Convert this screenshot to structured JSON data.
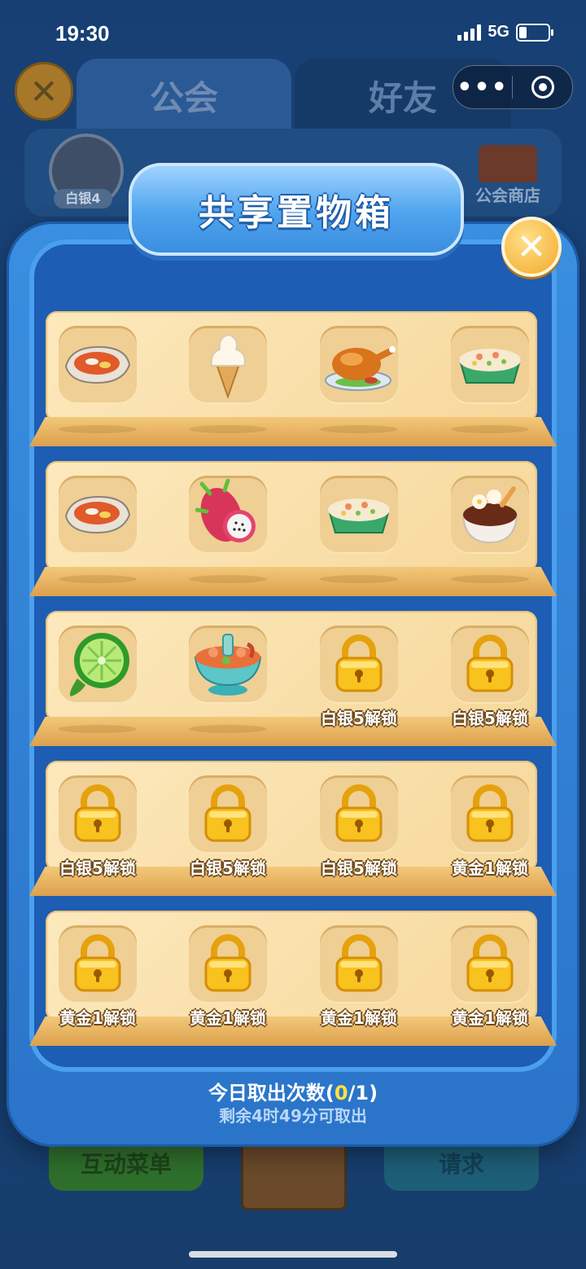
{
  "status_bar": {
    "time": "19:30",
    "network": "5G",
    "battery_level": 0.25
  },
  "background": {
    "tabs": [
      {
        "label": "公会"
      },
      {
        "label": "好友"
      }
    ],
    "badge": {
      "rank": "白银4"
    },
    "guild_shop": {
      "label": "公会商店"
    },
    "bottom": {
      "menu_label": "互动菜单",
      "request_label": "请求"
    },
    "mini_program": {
      "more": "•••"
    }
  },
  "modal": {
    "title": "共享置物箱",
    "close": "✕",
    "shelves": [
      {
        "slots": [
          {
            "item": "oyster-dish-icon",
            "label": ""
          },
          {
            "item": "ice-cream-icon",
            "label": ""
          },
          {
            "item": "roast-chicken-icon",
            "label": ""
          },
          {
            "item": "fried-rice-icon",
            "label": ""
          }
        ]
      },
      {
        "slots": [
          {
            "item": "oyster-dish-icon",
            "label": ""
          },
          {
            "item": "dragon-fruit-icon",
            "label": ""
          },
          {
            "item": "fried-rice-icon",
            "label": ""
          },
          {
            "item": "chocolate-dessert-icon",
            "label": ""
          }
        ]
      },
      {
        "slots": [
          {
            "item": "lime-icon",
            "label": ""
          },
          {
            "item": "hotpot-bowl-icon",
            "label": ""
          },
          {
            "item": "lock-icon",
            "label": "白银5解锁"
          },
          {
            "item": "lock-icon",
            "label": "白银5解锁"
          }
        ]
      },
      {
        "slots": [
          {
            "item": "lock-icon",
            "label": "白银5解锁"
          },
          {
            "item": "lock-icon",
            "label": "白银5解锁"
          },
          {
            "item": "lock-icon",
            "label": "白银5解锁"
          },
          {
            "item": "lock-icon",
            "label": "黄金1解锁"
          }
        ]
      },
      {
        "slots": [
          {
            "item": "lock-icon",
            "label": "黄金1解锁"
          },
          {
            "item": "lock-icon",
            "label": "黄金1解锁"
          },
          {
            "item": "lock-icon",
            "label": "黄金1解锁"
          },
          {
            "item": "lock-icon",
            "label": "黄金1解锁"
          }
        ]
      }
    ],
    "footer": {
      "count_prefix": "今日取出次数(",
      "count_used": "0",
      "count_suffix": "/1)",
      "remaining": "剩余4时49分可取出"
    }
  }
}
